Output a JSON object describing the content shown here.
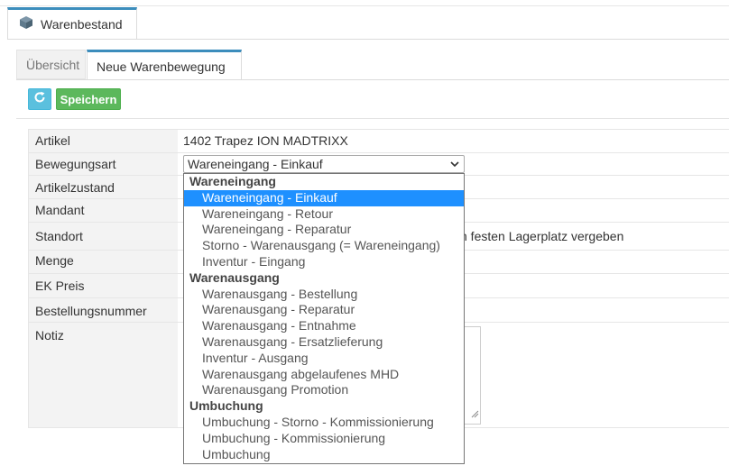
{
  "main_tab": {
    "label": "Warenbestand",
    "icon": "cube-icon"
  },
  "subtabs": [
    {
      "label": "Übersicht"
    },
    {
      "label": "Neue Warenbewegung"
    }
  ],
  "toolbar": {
    "refresh_icon": "refresh-icon",
    "save_label": "Speichern"
  },
  "form": {
    "labels": {
      "artikel": "Artikel",
      "bewegungsart": "Bewegungsart",
      "artikelzustand": "Artikelzustand",
      "mandant": "Mandant",
      "standort": "Standort",
      "menge": "Menge",
      "ek_preis": "EK Preis",
      "bestellungsnummer": "Bestellungsnummer",
      "notiz": "Notiz"
    },
    "artikel_value": "1402 Trapez ION MADTRIXX",
    "bewegungsart_value": "Wareneingang - Einkauf",
    "standort_value": "n festen Lagerplatz vergeben"
  },
  "dropdown": {
    "items": [
      {
        "text": "Wareneingang",
        "type": "group"
      },
      {
        "text": "Wareneingang - Einkauf",
        "type": "selected"
      },
      {
        "text": "Wareneingang - Retour",
        "type": "option"
      },
      {
        "text": "Wareneingang - Reparatur",
        "type": "option"
      },
      {
        "text": "Storno - Warenausgang (= Wareneingang)",
        "type": "option"
      },
      {
        "text": "Inventur - Eingang",
        "type": "option"
      },
      {
        "text": "Warenausgang",
        "type": "group"
      },
      {
        "text": "Warenausgang - Bestellung",
        "type": "option"
      },
      {
        "text": "Warenausgang - Reparatur",
        "type": "option"
      },
      {
        "text": "Warenausgang - Entnahme",
        "type": "option"
      },
      {
        "text": "Warenausgang - Ersatzlieferung",
        "type": "option"
      },
      {
        "text": "Inventur - Ausgang",
        "type": "option"
      },
      {
        "text": "Warenausgang abgelaufenes MHD",
        "type": "option"
      },
      {
        "text": "Warenausgang Promotion",
        "type": "option"
      },
      {
        "text": "Umbuchung",
        "type": "group"
      },
      {
        "text": "Umbuchung - Storno - Kommissionierung",
        "type": "option"
      },
      {
        "text": "Umbuchung - Kommissionierung",
        "type": "option"
      },
      {
        "text": "Umbuchung",
        "type": "option"
      }
    ]
  }
}
